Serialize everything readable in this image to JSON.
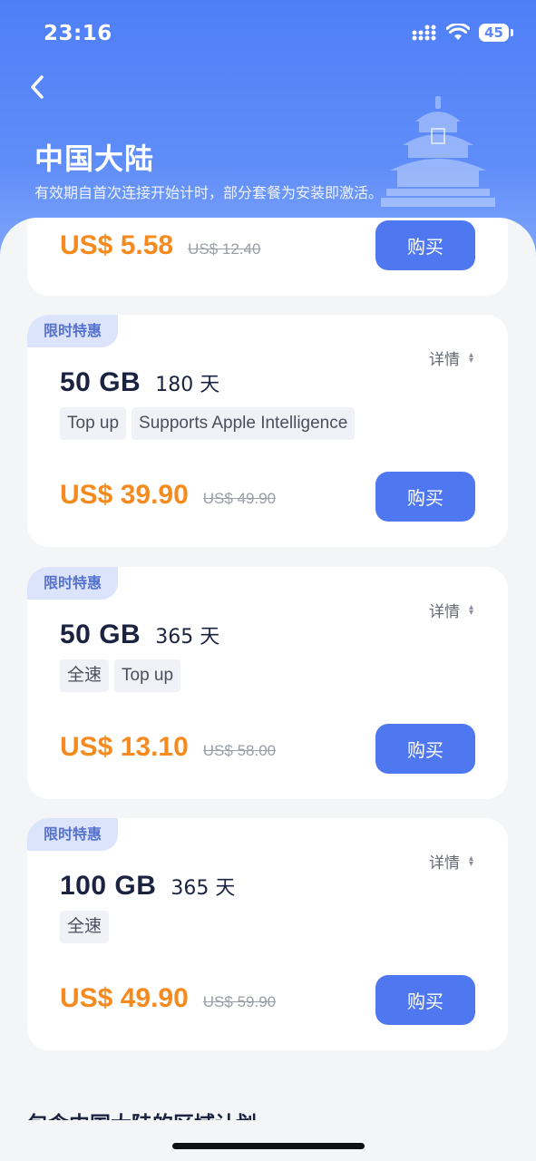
{
  "status": {
    "time": "23:16",
    "battery": "45"
  },
  "header": {
    "title": "中国大陆",
    "subtitle": "有效期自首次连接开始计时，部分套餐为安装即激活。"
  },
  "plans": [
    {
      "price": "US$ 5.58",
      "original_price": "US$ 12.40",
      "buy_label": "购买"
    },
    {
      "badge": "限时特惠",
      "details_label": "详情",
      "data": "50 GB",
      "duration": "180 天",
      "tags": [
        "Top up",
        "Supports Apple Intelligence"
      ],
      "price": "US$ 39.90",
      "original_price": "US$ 49.90",
      "buy_label": "购买"
    },
    {
      "badge": "限时特惠",
      "details_label": "详情",
      "data": "50 GB",
      "duration": "365 天",
      "tags": [
        "全速",
        "Top up"
      ],
      "price": "US$ 13.10",
      "original_price": "US$ 58.00",
      "buy_label": "购买"
    },
    {
      "badge": "限时特惠",
      "details_label": "详情",
      "data": "100 GB",
      "duration": "365 天",
      "tags": [
        "全速"
      ],
      "price": "US$ 49.90",
      "original_price": "US$ 59.90",
      "buy_label": "购买"
    }
  ],
  "next_section_title": "包含中国大陆的区域计划",
  "icons": [
    "back-arrow-icon",
    "signal-icon",
    "wifi-icon",
    "battery-icon",
    "temple-of-heaven-icon",
    "sort-icon"
  ],
  "colors": {
    "accent": "#4f78f0",
    "price": "#f58a1f",
    "header": "#5b87f7"
  }
}
